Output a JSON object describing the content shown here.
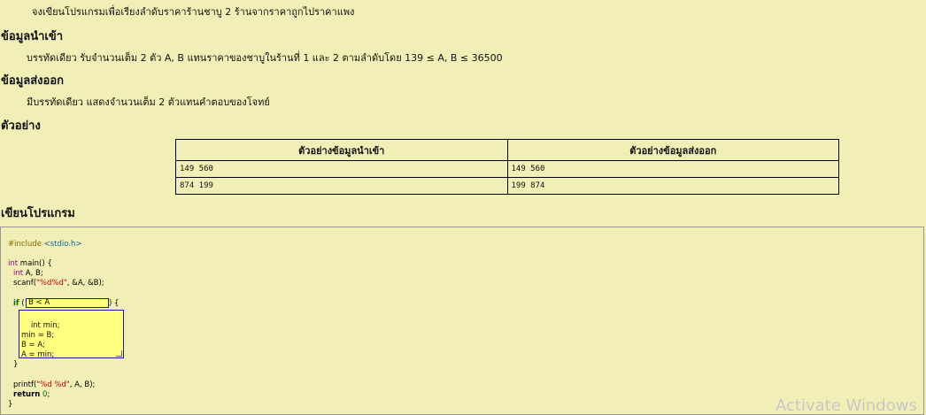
{
  "problem": {
    "statement": "จงเขียนโปรแกรมเพื่อเรียงลำดับราคาร้านชาบู 2 ร้านจากราคาถูกไปราคาแพง",
    "input_heading": "ข้อมูลนำเข้า",
    "input_text": "บรรทัดเดียว รับจำนวนเต็ม 2 ตัว A, B แทนราคาของชาบูในร้านที่ 1 และ 2 ตามลำดับโดย 139 ≤ A, B ≤ 36500",
    "output_heading": "ข้อมูลส่งออก",
    "output_text": "มีบรรทัดเดียว แสดงจำนวนเต็ม 2 ตัวแทนคำตอบของโจทย์",
    "example_heading": "ตัวอย่าง",
    "write_heading": "เขียนโปรแกรม"
  },
  "examples": {
    "headers": [
      "ตัวอย่างข้อมูลนำเข้า",
      "ตัวอย่างข้อมูลส่งออก"
    ],
    "rows": [
      [
        "149 560",
        "149 560"
      ],
      [
        "874 199",
        "199 874"
      ]
    ]
  },
  "code": {
    "include_kw": "#include",
    "include_hdr": "<stdio.h>",
    "main_type": "int",
    "main_sig": " main() {",
    "decl_type": "int",
    "decl_vars": " A, B;",
    "scanf_pre": "scanf(",
    "scanf_fmt": "\"%d%d\"",
    "scanf_post": ", &A, &B);",
    "if_kw": "if",
    "if_open": "(",
    "condition_value": "B < A",
    "if_close": ") {",
    "body_value": "int min;\nmin = B;\nB = A;\nA = min;",
    "close_brace_inner": "}",
    "printf_pre": "printf(",
    "printf_fmt": "\"%d %d\"",
    "printf_post": ", A, B);",
    "return_kw": "return",
    "return_val": "0",
    "return_end": ";",
    "close_brace_outer": "}"
  },
  "watermark": "Activate Windows"
}
